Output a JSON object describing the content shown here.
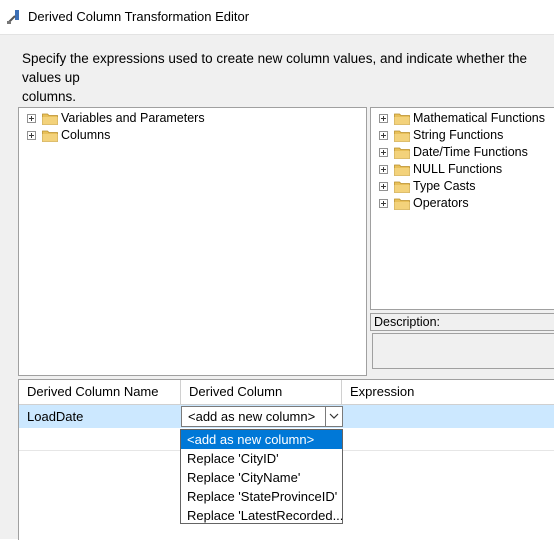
{
  "window": {
    "title": "Derived Column Transformation Editor",
    "icon": "derived-column-icon"
  },
  "intro_text": "Specify the expressions used to create new column values, and indicate whether the values up columns.",
  "intro_line1": "Specify the expressions used to create new column values, and indicate whether the values up",
  "intro_line2": "columns.",
  "left_tree": {
    "items": [
      {
        "label": "Variables and Parameters",
        "icon": "folder-icon"
      },
      {
        "label": "Columns",
        "icon": "folder-icon"
      }
    ]
  },
  "right_tree": {
    "items": [
      {
        "label": "Mathematical Functions",
        "icon": "folder-icon"
      },
      {
        "label": "String Functions",
        "icon": "folder-icon"
      },
      {
        "label": "Date/Time Functions",
        "icon": "folder-icon"
      },
      {
        "label": "NULL Functions",
        "icon": "folder-icon"
      },
      {
        "label": "Type Casts",
        "icon": "folder-icon"
      },
      {
        "label": "Operators",
        "icon": "folder-icon"
      }
    ]
  },
  "description": {
    "label": "Description:",
    "text": ""
  },
  "grid": {
    "columns": [
      "Derived Column Name",
      "Derived Column",
      "Expression"
    ],
    "rows": [
      {
        "name": "LoadDate",
        "derived_column": "<add as new column>",
        "expression": ""
      }
    ]
  },
  "dropdown": {
    "options": [
      "<add as new column>",
      "Replace 'CityID'",
      "Replace 'CityName'",
      "Replace 'StateProvinceID'",
      "Replace 'LatestRecorded..."
    ],
    "selected": "<add as new column>"
  },
  "colors": {
    "selection_row": "#cce8ff",
    "selected_item": "#0078d7",
    "folder": "#e8c05a"
  }
}
